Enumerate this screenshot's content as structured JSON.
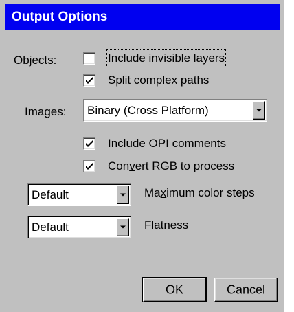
{
  "window": {
    "title": "Output Options"
  },
  "objects": {
    "section_label": "Objects:",
    "include_invisible": {
      "pre": "",
      "accel": "I",
      "post": "nclude invisible layers",
      "checked": false
    },
    "split_paths": {
      "pre": "Sp",
      "accel": "l",
      "post": "it complex paths",
      "checked": true
    }
  },
  "images": {
    "section_label": "Images:",
    "format_value": "Binary (Cross Platform)",
    "include_opi": {
      "pre": "Include ",
      "accel": "O",
      "post": "PI comments",
      "checked": true
    },
    "convert_rgb": {
      "pre": "Con",
      "accel": "v",
      "post": "ert RGB to process",
      "checked": true
    }
  },
  "color_steps": {
    "value": "Default",
    "label": {
      "pre": "Ma",
      "accel": "x",
      "post": "imum color steps"
    }
  },
  "flatness": {
    "value": "Default",
    "label": {
      "pre": "",
      "accel": "F",
      "post": "latness"
    }
  },
  "buttons": {
    "ok": "OK",
    "cancel": "Cancel"
  },
  "icons": {
    "check": "check-mark-icon",
    "dropdown": "dropdown-arrow-icon"
  }
}
